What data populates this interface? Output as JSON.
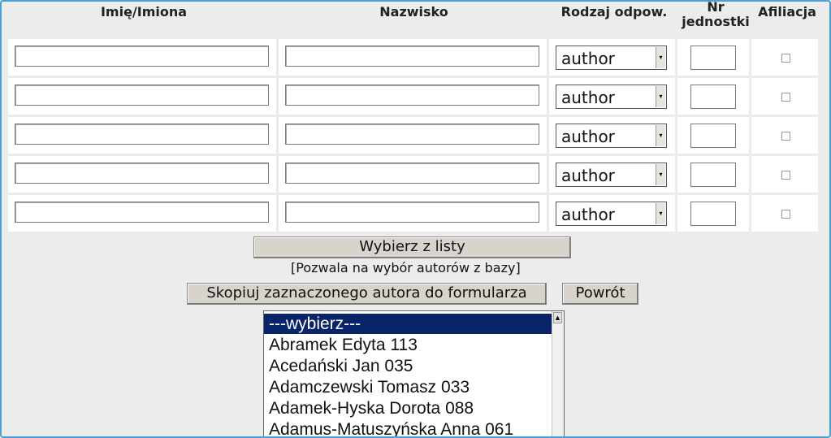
{
  "headers": {
    "first_name": "Imię/Imiona",
    "last_name": "Nazwisko",
    "role": "Rodzaj odpow.",
    "unit_no": "Nr\njednostki",
    "affiliation": "Afiliacja"
  },
  "rows": [
    {
      "first_name": "",
      "last_name": "",
      "role": "author",
      "unit_no": "",
      "affiliation": false
    },
    {
      "first_name": "",
      "last_name": "",
      "role": "author",
      "unit_no": "",
      "affiliation": false
    },
    {
      "first_name": "",
      "last_name": "",
      "role": "author",
      "unit_no": "",
      "affiliation": false
    },
    {
      "first_name": "",
      "last_name": "",
      "role": "author",
      "unit_no": "",
      "affiliation": false
    },
    {
      "first_name": "",
      "last_name": "",
      "role": "author",
      "unit_no": "",
      "affiliation": false
    }
  ],
  "actions": {
    "choose_from_list": "Wybierz z listy",
    "choose_note": "[Pozwala na wybór autorów z bazy]",
    "copy_selected": "Skopiuj zaznaczonego autora do formularza",
    "back": "Powrót"
  },
  "author_list": {
    "options": [
      "---wybierz---",
      "Abramek Edyta 113",
      "Acedański Jan 035",
      "Adamczewski Tomasz 033",
      "Adamek-Hyska Dorota 088",
      "Adamus-Matuszyńska Anna 061"
    ],
    "selected_index": 0
  },
  "colors": {
    "selected_bg": "#0a246a",
    "frame_border": "#4aa0d8"
  }
}
